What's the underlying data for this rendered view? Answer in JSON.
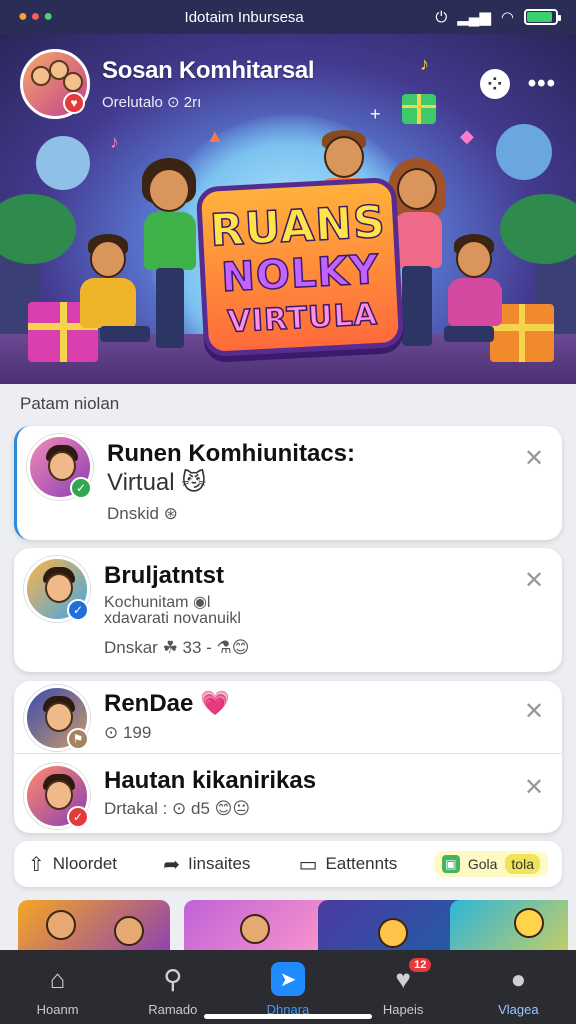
{
  "status_bar": {
    "left_icons": [
      "app-icon-orange",
      "app-icon-red",
      "app-icon-green"
    ],
    "title": "Idotaim Inbursesa",
    "battery_level": 0.9
  },
  "hero": {
    "title": "Sosan Komhitarsal",
    "subtitle": "Orelutalo ⊙ 2rı",
    "logo_lines": [
      "RUANS",
      "NOLKY",
      "VIRTULA"
    ]
  },
  "section_label": "Patam niolan",
  "cards": [
    {
      "title_line1": "Runen Komhiunitacs:",
      "title_line2": "Virtual 😼",
      "meta": "Dnskid ⊛",
      "badge_color": "#2fa84f",
      "badge_glyph": "✓"
    },
    {
      "title": "Bruljatntst",
      "sub_line1": "Kochunitam ◉l",
      "sub_line2": "xdavarati novanuikl",
      "meta": "Dnskar ☘ 33 - ⚗😊",
      "badge_color": "#1f6fd8",
      "badge_glyph": "✓"
    },
    {
      "title": "RenDae 💗",
      "meta": "⊙ 199",
      "badge_color": "#a48363",
      "badge_glyph": "⚑"
    },
    {
      "title": "Hautan kikanirikas",
      "meta": "Drtakal : ⊙ d5 😊😐",
      "badge_color": "#e53a3a",
      "badge_glyph": "✓"
    }
  ],
  "close_glyph": "✕",
  "actions": {
    "item1": "Nloordet",
    "item2": "Iinsaites",
    "item3": "Eattennts",
    "chip_text": "Gola",
    "chip_pill": "tola"
  },
  "bottom_nav": {
    "items": [
      {
        "label": "Hoanm",
        "icon": "home-icon"
      },
      {
        "label": "Ramado",
        "icon": "search-icon"
      },
      {
        "label": "Dhnara",
        "icon": "send-icon"
      },
      {
        "label": "Hapeis",
        "icon": "heart-icon"
      },
      {
        "label": "Vlagea",
        "icon": "profile-icon"
      }
    ],
    "badge": "12"
  },
  "colors": {
    "accent": "#1e8cff",
    "nav_bg": "#2b2c31",
    "hero_bg": "#433a8f"
  }
}
